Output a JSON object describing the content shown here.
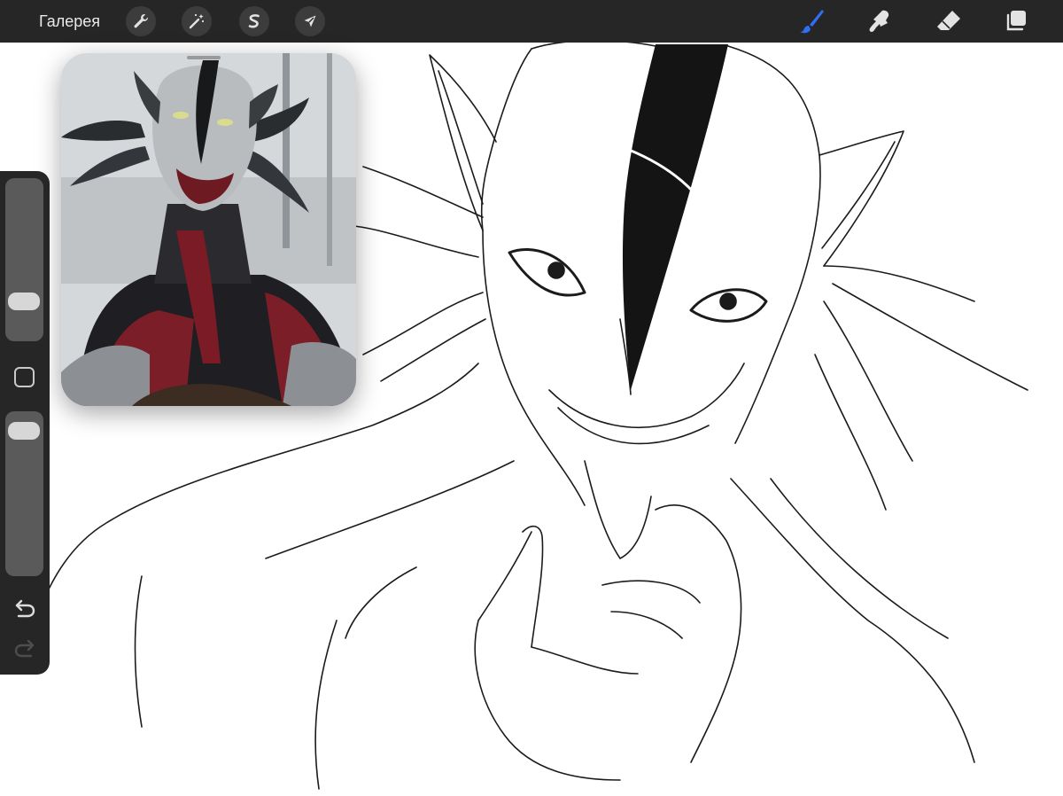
{
  "toolbar": {
    "gallery_label": "Галерея",
    "left_tools": [
      {
        "name": "actions",
        "icon": "wrench-icon"
      },
      {
        "name": "adjustments",
        "icon": "magic-wand-icon"
      },
      {
        "name": "selection",
        "icon": "selection-s-icon"
      },
      {
        "name": "transform",
        "icon": "arrow-cursor-icon"
      }
    ],
    "right_tools": [
      {
        "name": "brush",
        "icon": "brush-icon",
        "active": true
      },
      {
        "name": "smudge",
        "icon": "smudge-icon",
        "active": false
      },
      {
        "name": "eraser",
        "icon": "eraser-icon",
        "active": false
      },
      {
        "name": "layers",
        "icon": "layers-icon",
        "active": false
      }
    ]
  },
  "sidebar": {
    "brush_size_level": 0.2,
    "brush_opacity_level": 0.95
  },
  "colors": {
    "toolbar_bg": "#262626",
    "active_tool": "#2f6ff3",
    "icon": "#e3e3e3",
    "canvas": "#ffffff"
  }
}
